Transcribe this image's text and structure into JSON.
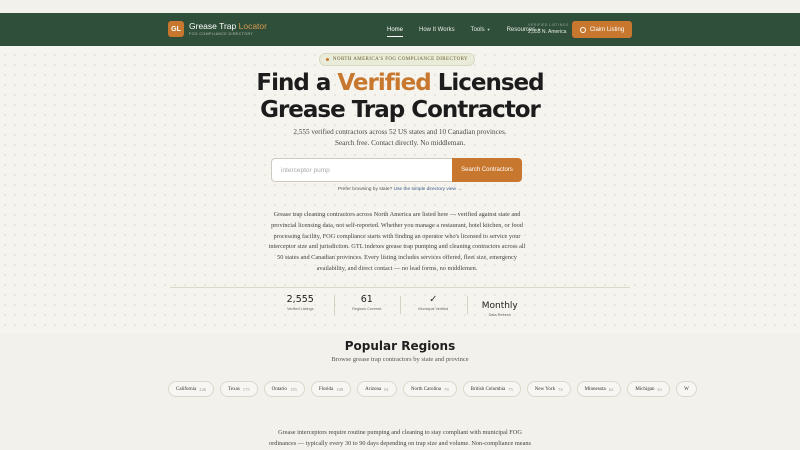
{
  "header": {
    "logo_initials": "GL",
    "brand_name": "Grease Trap",
    "brand_accent": "Locator",
    "brand_tagline": "FOG COMPLIANCE DIRECTORY",
    "nav": [
      {
        "label": "Home",
        "active": true
      },
      {
        "label": "How It Works",
        "active": false
      },
      {
        "label": "Tools",
        "active": false,
        "dropdown": true
      },
      {
        "label": "Resources",
        "active": false,
        "dropdown": true
      }
    ],
    "dropdown_icon": "chevron-down-icon",
    "verified_label": "VERIFIED LISTINGS",
    "verified_value": "2,555 N. America",
    "claim_label": "Claim Listing"
  },
  "hero": {
    "badge": "NORTH AMERICA'S FOG COMPLIANCE DIRECTORY",
    "title_part1": "Find a ",
    "title_accent": "Verified",
    "title_part2": " Licensed",
    "title_line2": "Grease Trap Contractor",
    "subtitle_line1": "2,555 verified contractors across 52 US states and 10 Canadian provinces.",
    "subtitle_line2": "Search free. Contact directly. No middleman."
  },
  "search": {
    "placeholder": "interceptor pump",
    "button_label": "Search Contractors",
    "browse_prefix": "Prefer browsing by state? ",
    "browse_link": "Use the simple directory view →"
  },
  "intro": "Grease trap cleaning contractors across North America are listed here — verified against state and provincial licensing data, not self-reported. Whether you manage a restaurant, hotel kitchen, or food processing facility, FOG compliance starts with finding an operator who's licensed to service your interceptor size and jurisdiction. GTL indexes grease trap pumping and cleaning contractors across all 50 states and Canadian provinces. Every listing includes services offered, fleet size, emergency availability, and direct contact — no lead forms, no middlemen.",
  "stats": [
    {
      "value": "2,555",
      "label": "Verified Listings"
    },
    {
      "value": "61",
      "label": "Regions Covered"
    },
    {
      "value": "✓",
      "label": "Municipal Verified"
    },
    {
      "value": "Monthly",
      "label": "Data Refresh"
    }
  ],
  "popular": {
    "title": "Popular Regions",
    "subtitle": "Browse grease trap contractors by state and province",
    "regions": [
      {
        "name": "California",
        "count": "226"
      },
      {
        "name": "Texas",
        "count": "175"
      },
      {
        "name": "Ontario",
        "count": "155"
      },
      {
        "name": "Florida",
        "count": "108"
      },
      {
        "name": "Arizona",
        "count": "81"
      },
      {
        "name": "North Carolina",
        "count": "78"
      },
      {
        "name": "British Columbia",
        "count": "75"
      },
      {
        "name": "New York",
        "count": "74"
      },
      {
        "name": "Minnesota",
        "count": "62"
      },
      {
        "name": "Michigan",
        "count": "61"
      },
      {
        "name": "W",
        "count": ""
      }
    ]
  },
  "bottom_text": "Grease interceptors require routine pumping and cleaning to stay compliant with municipal FOG ordinances — typically every 30 to 90 days depending on trap size and volume. Non-compliance means",
  "colors": {
    "nav_bg": "#2f4f3a",
    "accent": "#c8772e",
    "page_bg": "#f6f4ee"
  }
}
